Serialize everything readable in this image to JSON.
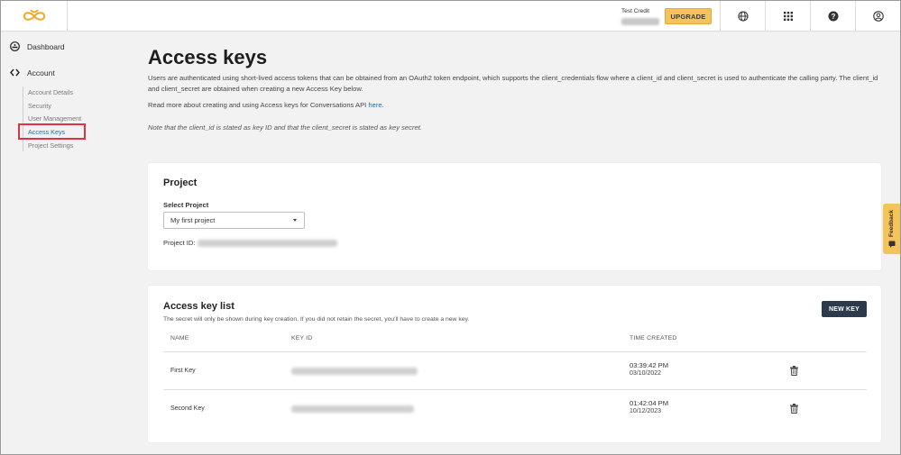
{
  "topbar": {
    "logo_icon": "infinity-logo-icon",
    "credit_label": "Test Credit",
    "upgrade_label": "UPGRADE",
    "icons": [
      "globe-icon",
      "apps-grid-icon",
      "help-icon",
      "user-account-icon"
    ]
  },
  "sidebar": {
    "dashboard_label": "Dashboard",
    "account_label": "Account",
    "sub_items": [
      "Account Details",
      "Security",
      "User Management",
      "Access Keys",
      "Project Settings"
    ],
    "active_item": "Access Keys"
  },
  "main": {
    "title": "Access keys",
    "intro": "Users are authenticated using short-lived access tokens that can be obtained from an OAuth2 token endpoint, which supports the client_credentials flow where a client_id and client_secret is used to authenticate the calling party. The client_id and client_secret are obtained when creating a new Access Key below.",
    "readmore_text": "Read more about creating and using Access keys for Conversations API ",
    "readmore_link": "here",
    "readmore_end": ".",
    "note": "Note that the client_id is stated as key ID and that the client_secret is stated as key secret."
  },
  "project": {
    "title": "Project",
    "select_label": "Select Project",
    "selected_project": "My first project",
    "project_id_label": "Project ID:"
  },
  "keys": {
    "title": "Access key list",
    "subtext": "The secret will only be shown during key creation. If you did not retain the secret, you'll have to create a new key.",
    "new_key_label": "NEW KEY",
    "columns": [
      "NAME",
      "KEY ID",
      "TIME CREATED"
    ],
    "rows": [
      {
        "name": "First Key",
        "time": "03:39:42 PM",
        "date": "03/10/2022"
      },
      {
        "name": "Second Key",
        "time": "01:42:04 PM",
        "date": "10/12/2023"
      }
    ]
  },
  "feedback_label": "Feedback",
  "colors": {
    "accent": "#f6c25a",
    "link": "#1f6fb5",
    "highlight": "#e0323c",
    "dark_button": "#2c3a4b"
  }
}
